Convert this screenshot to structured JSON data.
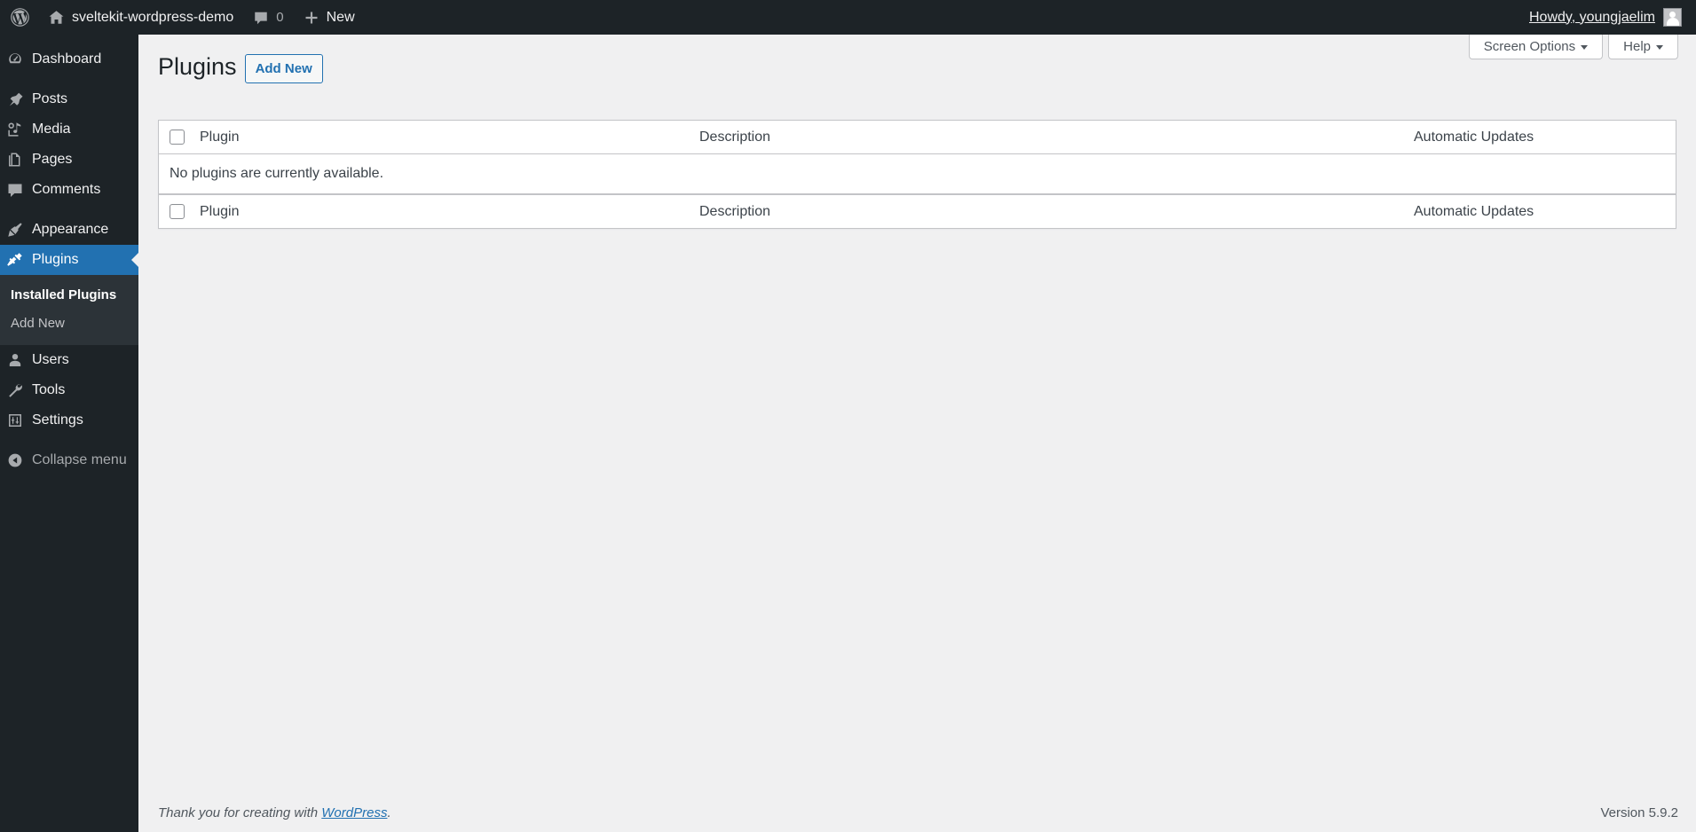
{
  "admin_bar": {
    "logo_icon": "wordpress-logo-icon",
    "site_name": "sveltekit-wordpress-demo",
    "site_icon": "home-icon",
    "comments_icon": "comment-bubble-icon",
    "comments_count": "0",
    "new_icon": "plus-icon",
    "new_label": "New",
    "howdy": "Howdy, youngjaelim",
    "avatar_icon": "user-avatar-icon"
  },
  "sidebar": {
    "items": [
      {
        "label": "Dashboard",
        "icon": "dashboard-gauge-icon",
        "current": false
      },
      {
        "label": "Posts",
        "icon": "pin-icon",
        "current": false
      },
      {
        "label": "Media",
        "icon": "media-camera-icon",
        "current": false
      },
      {
        "label": "Pages",
        "icon": "pages-icon",
        "current": false
      },
      {
        "label": "Comments",
        "icon": "comment-bubble-icon",
        "current": false
      },
      {
        "label": "Appearance",
        "icon": "paintbrush-icon",
        "current": false
      },
      {
        "label": "Plugins",
        "icon": "plug-icon",
        "current": true
      },
      {
        "label": "Users",
        "icon": "user-icon",
        "current": false
      },
      {
        "label": "Tools",
        "icon": "wrench-icon",
        "current": false
      },
      {
        "label": "Settings",
        "icon": "settings-sliders-icon",
        "current": false
      }
    ],
    "plugins_submenu": [
      {
        "label": "Installed Plugins",
        "current": true
      },
      {
        "label": "Add New",
        "current": false
      }
    ],
    "collapse": {
      "label": "Collapse menu",
      "icon": "collapse-arrow-icon"
    }
  },
  "screen_meta": {
    "screen_options": "Screen Options",
    "help": "Help"
  },
  "page": {
    "title": "Plugins",
    "add_new": "Add New"
  },
  "table": {
    "columns": {
      "checkbox": "select-all-checkbox",
      "plugin": "Plugin",
      "description": "Description",
      "automatic_updates": "Automatic Updates"
    },
    "empty_message": "No plugins are currently available.",
    "rows": []
  },
  "footer": {
    "thanks_prefix": "Thank you for creating with ",
    "wordpress_link": "WordPress",
    "thanks_suffix": ".",
    "version": "Version 5.9.2"
  },
  "colors": {
    "admin_dark": "#1d2327",
    "submenu_bg": "#2c3338",
    "accent_blue": "#2271b1",
    "body_bg": "#f0f0f1",
    "border": "#c3c4c7"
  }
}
